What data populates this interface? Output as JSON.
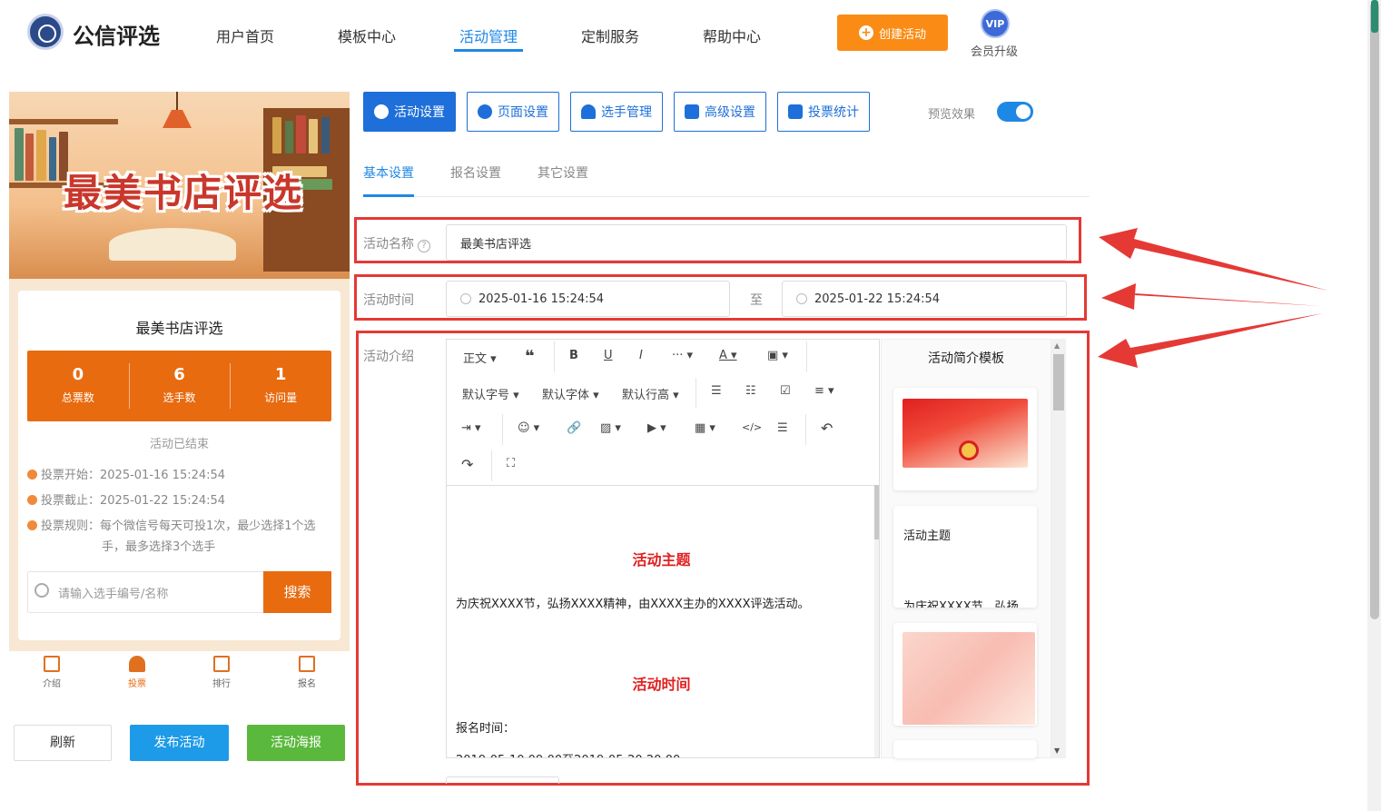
{
  "brand": {
    "name": "公信评选"
  },
  "nav": {
    "items": [
      "用户首页",
      "模板中心",
      "活动管理",
      "定制服务",
      "帮助中心"
    ],
    "active": "活动管理"
  },
  "header": {
    "create_label": "创建活动",
    "vip_badge": "VIP",
    "vip_label": "会员升级"
  },
  "preview": {
    "banner_title": "最美书店评选",
    "title": "最美书店评选",
    "stats": [
      {
        "value": "0",
        "label": "总票数"
      },
      {
        "value": "6",
        "label": "选手数"
      },
      {
        "value": "1",
        "label": "访问量"
      }
    ],
    "status": "活动已结束",
    "vote_start": "投票开始：2025-01-16 15:24:54",
    "vote_end": "投票截止：2025-01-22 15:24:54",
    "vote_rule_1": "投票规则：每个微信号每天可投1次，最少选择1个选",
    "vote_rule_2": "手，最多选择3个选手",
    "search_placeholder": "请输入选手编号/名称",
    "search_button": "搜索",
    "tabs": [
      "介绍",
      "投票",
      "排行",
      "报名"
    ],
    "active_tab": "投票"
  },
  "actions": {
    "refresh": "刷新",
    "publish": "发布活动",
    "poster": "活动海报"
  },
  "top_tabs": [
    "活动设置",
    "页面设置",
    "选手管理",
    "高级设置",
    "投票统计"
  ],
  "preview_toggle": {
    "label": "预览效果",
    "on": true
  },
  "sub_tabs": [
    "基本设置",
    "报名设置",
    "其它设置"
  ],
  "form": {
    "name_label": "活动名称",
    "name_value": "最美书店评选",
    "time_label": "活动时间",
    "time_start": "2025-01-16 15:24:54",
    "time_sep": "至",
    "time_end": "2025-01-22 15:24:54",
    "intro_label": "活动介绍"
  },
  "editor": {
    "toolbar": {
      "paragraph": "正文",
      "font_size": "默认字号",
      "font_family": "默认字体",
      "line_height": "默认行高"
    },
    "heading1": "活动主题",
    "para1": "为庆祝XXXX节，弘扬XXXX精神，由XXXX主办的XXXX评选活动。",
    "heading2": "活动时间",
    "para2": "报名时间：",
    "para3": "2019-05-10 09:00至2019-05-20 20:00"
  },
  "templates": {
    "title": "活动简介模板",
    "card2_title": "活动主题",
    "card2_text": "为庆祝XXXX节，弘扬"
  },
  "colors": {
    "primary": "#1e6fd9",
    "orange": "#e86b10",
    "green": "#5ab93c",
    "annotation_red": "#e53935"
  }
}
